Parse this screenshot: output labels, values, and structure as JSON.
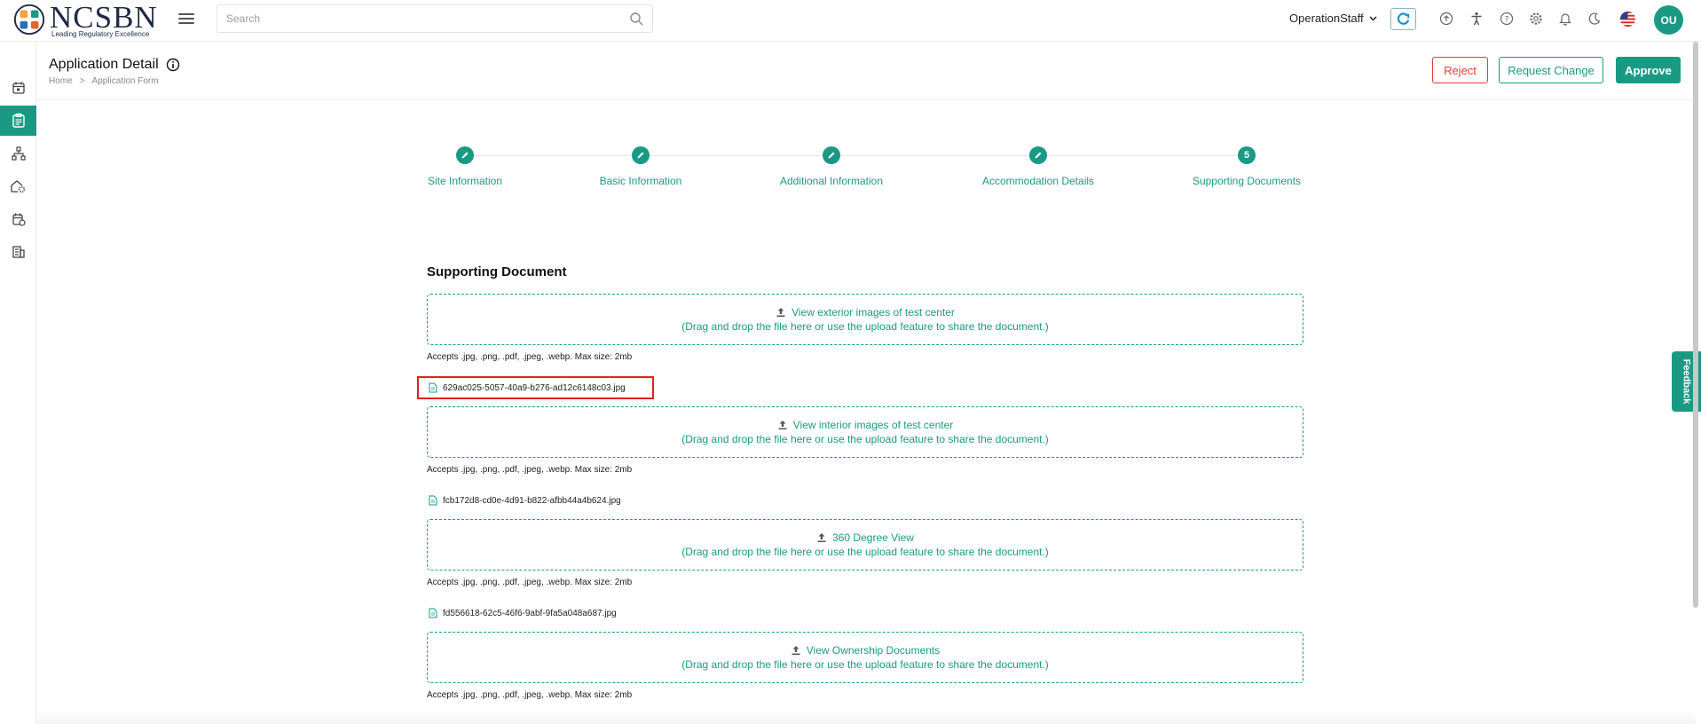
{
  "brand": {
    "name": "NCSBN",
    "tagline": "Leading Regulatory Excellence"
  },
  "search": {
    "placeholder": "Search"
  },
  "user": {
    "role": "OperationStaff",
    "initials": "OU"
  },
  "header_icons": [
    "upload-circle-icon",
    "accessibility-icon",
    "help-icon",
    "settings-icon",
    "bell-icon",
    "moon-icon",
    "us-flag-icon"
  ],
  "sidebar": {
    "items": [
      "calendar-icon",
      "clipboard-icon",
      "org-chart-icon",
      "building-gear-icon",
      "calendar-clock-icon",
      "building-icon"
    ],
    "active_index": 1
  },
  "page": {
    "title": "Application Detail",
    "breadcrumb": [
      "Home",
      ">",
      "Application Form"
    ]
  },
  "actions": {
    "reject": "Reject",
    "request_change": "Request Change",
    "approve": "Approve"
  },
  "stepper": {
    "steps": [
      {
        "label": "Site Information",
        "state": "done"
      },
      {
        "label": "Basic Information",
        "state": "done"
      },
      {
        "label": "Additional Information",
        "state": "done"
      },
      {
        "label": "Accommodation Details",
        "state": "done"
      },
      {
        "label": "Supporting Documents",
        "state": "current",
        "number": "5"
      }
    ]
  },
  "documents": {
    "title": "Supporting Document",
    "drop_hint": "(Drag and drop the file here or use the upload feature to share the document.)",
    "accepts": "Accepts .jpg, .png, .pdf, .jpeg, .webp. Max size: 2mb",
    "sections": [
      {
        "label": "View exterior images of test center",
        "file": "629ac025-5057-40a9-b276-ad12c6148c03.jpg"
      },
      {
        "label": "View interior images of test center",
        "file": "fcb172d8-cd0e-4d91-b822-afbb44a4b624.jpg"
      },
      {
        "label": "360 Degree View",
        "file": "fd556618-62c5-46f6-9abf-9fa5a048a687.jpg"
      },
      {
        "label": "View Ownership Documents",
        "file": ""
      }
    ]
  },
  "feedback": {
    "label": "Feedback"
  },
  "colors": {
    "accent": "#1a9a84",
    "danger": "#e0403a"
  }
}
